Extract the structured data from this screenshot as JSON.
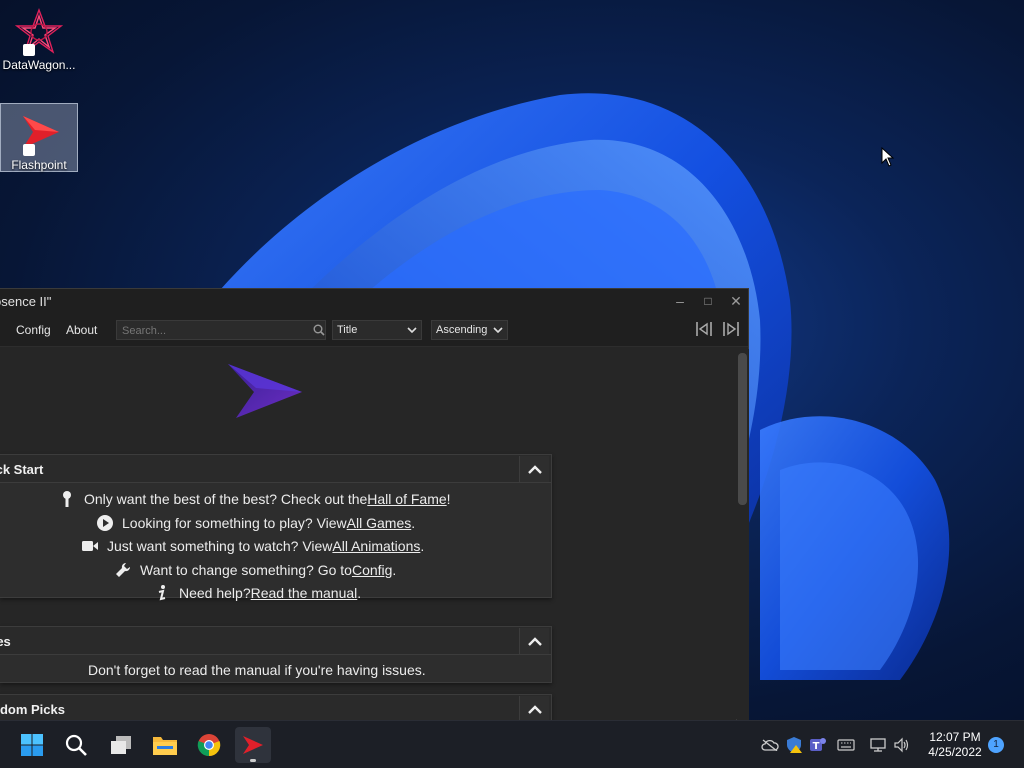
{
  "desktop": {
    "icons": [
      {
        "label": "DataWagon..."
      },
      {
        "label": "Flashpoint"
      }
    ]
  },
  "window": {
    "title": "osence II\"",
    "controls": {
      "minimize": "–",
      "maximize": "□",
      "close": "✕"
    }
  },
  "toolbar": {
    "config_label": "Config",
    "about_label": "About",
    "search_placeholder": "Search...",
    "sort_field": "Title",
    "sort_order": "Ascending"
  },
  "quick_start": {
    "title": "ick Start",
    "lines": [
      {
        "prefix": "Only want the best of the best? Check out the ",
        "link": "Hall of Fame",
        "suffix": "!"
      },
      {
        "prefix": "Looking for something to play? View ",
        "link": "All Games",
        "suffix": "."
      },
      {
        "prefix": "Just want something to watch? View ",
        "link": "All Animations",
        "suffix": "."
      },
      {
        "prefix": "Want to change something? Go to ",
        "link": "Config",
        "suffix": "."
      },
      {
        "prefix": "Need help? ",
        "link": "Read the manual",
        "suffix": "."
      }
    ]
  },
  "notes": {
    "title": "tes",
    "text": "Don't forget to read the manual if you're having issues."
  },
  "random_picks": {
    "title": "ndom Picks"
  },
  "taskbar": {
    "time": "12:07 PM",
    "date": "4/25/2022",
    "notification_count": "1"
  },
  "colors": {
    "accent": "#4ea3ff",
    "flashpoint_red": "#e0202a",
    "logo_purple": "#6a2bd8"
  }
}
